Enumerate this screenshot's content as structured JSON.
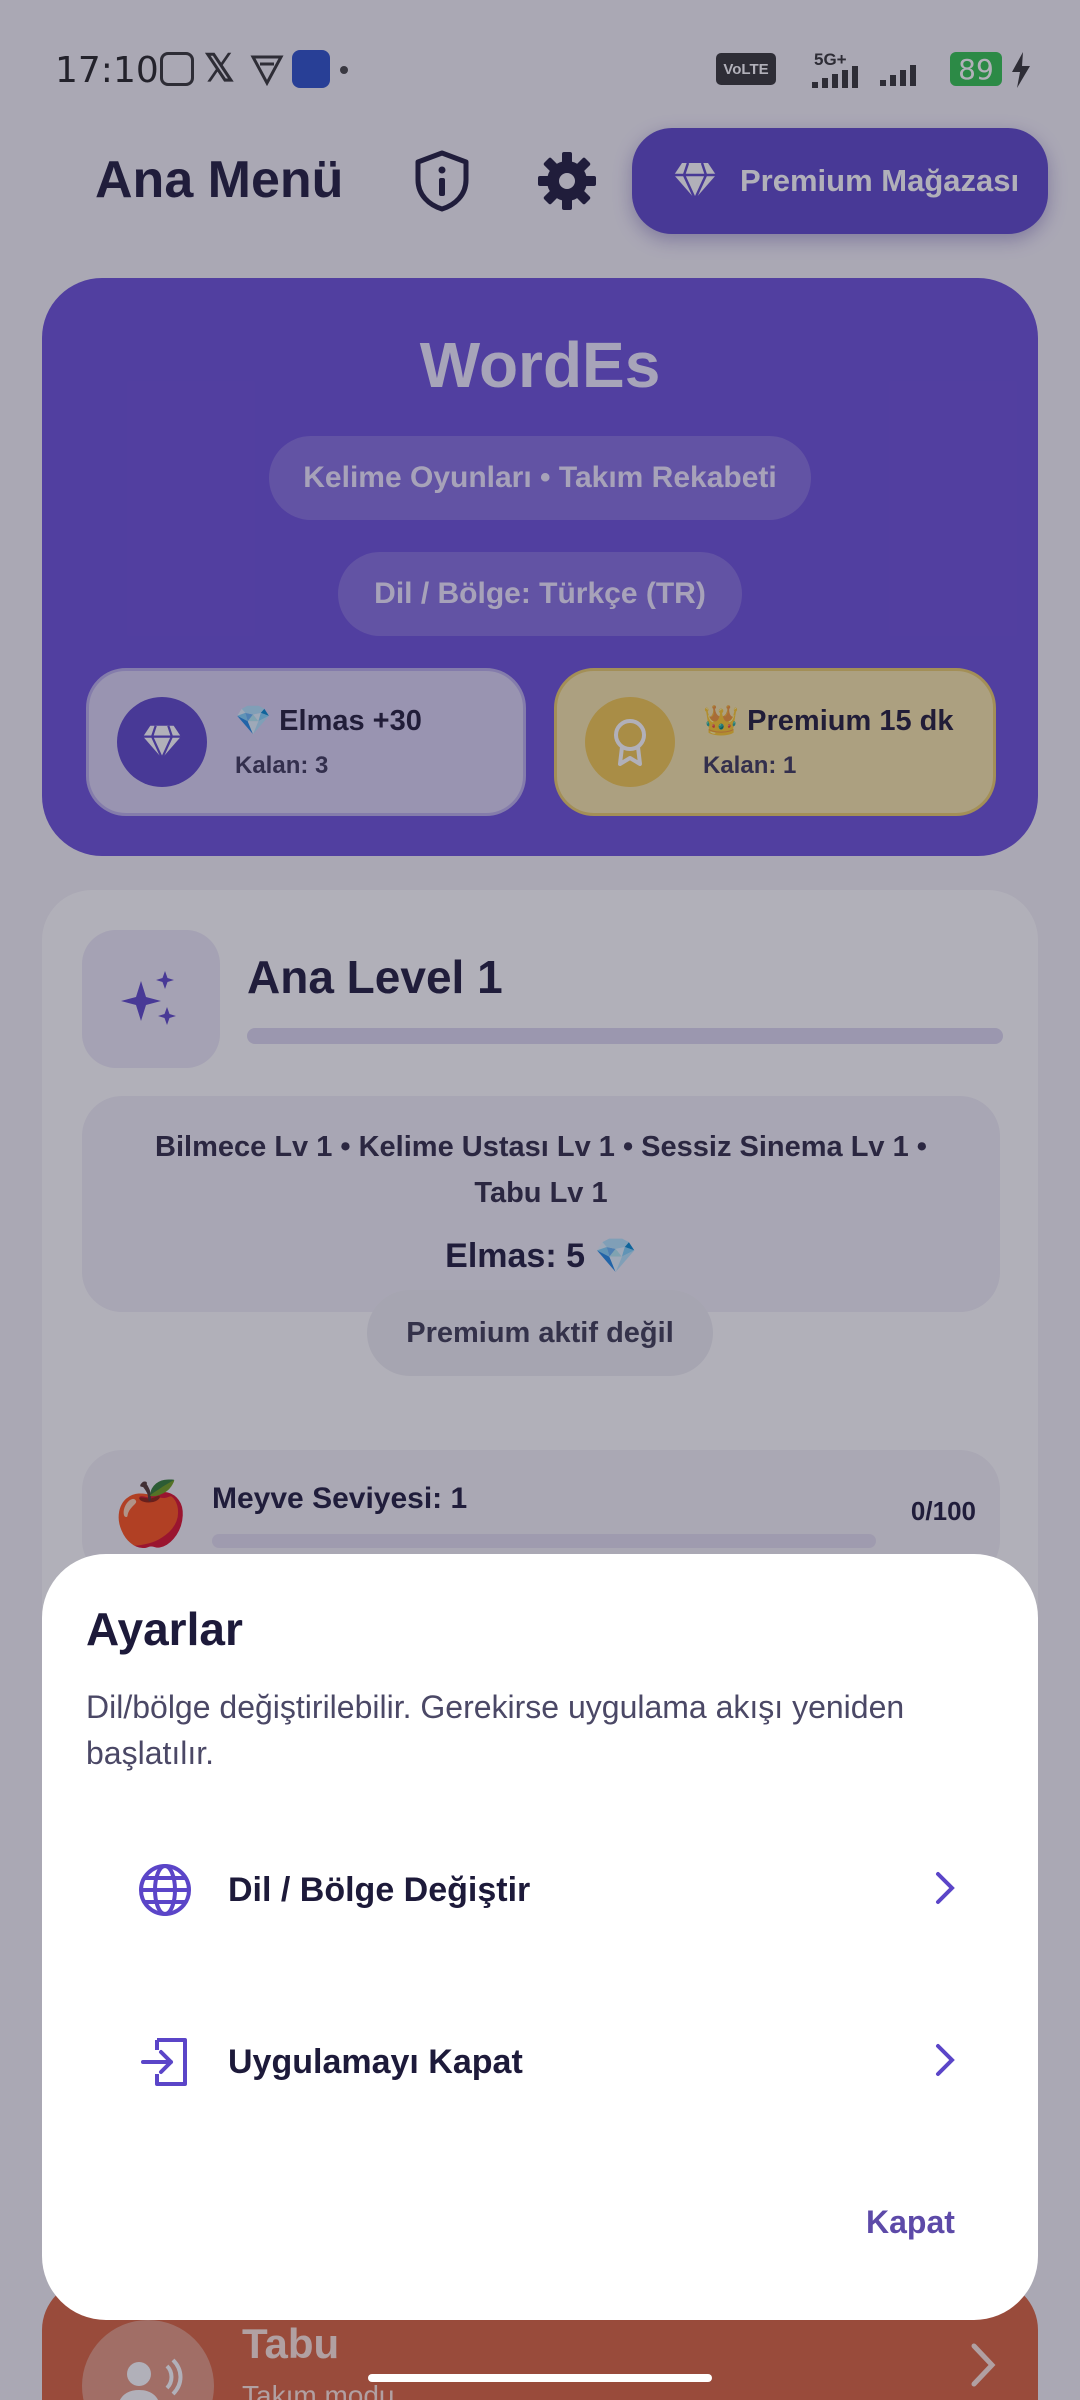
{
  "status_bar": {
    "time": "17:10",
    "volte": "VoLTE",
    "network": "5G+",
    "battery": "89"
  },
  "header": {
    "title": "Ana Menü",
    "premium_store_label": "Premium Mağazası"
  },
  "hero": {
    "app_name": "WordEs",
    "tagline": "Kelime Oyunları • Takım Rekabeti",
    "language": "Dil / Bölge: Türkçe (TR)",
    "rewards": [
      {
        "title": "💎 Elmas +30",
        "remaining": "Kalan: 3"
      },
      {
        "title": "👑 Premium 15 dk",
        "remaining": "Kalan: 1"
      }
    ]
  },
  "level": {
    "title": "Ana Level 1",
    "modes": "Bilmece Lv 1 • Kelime Ustası Lv 1 • Sessiz Sinema Lv 1 • Tabu Lv 1",
    "gems": "Elmas: 5 💎",
    "premium_status": "Premium aktif değil",
    "fruit_emoji": "🍎",
    "fruit_label": "Meyve Seviyesi: 1",
    "fruit_count": "0/100",
    "fruit_progress": 0
  },
  "tabu_card": {
    "name": "Tabu",
    "subtitle": "Takım modu"
  },
  "dialog": {
    "title": "Ayarlar",
    "description": "Dil/bölge değiştirilebilir. Gerekirse uygulama akışı yeniden başlatılır.",
    "items": [
      {
        "label": "Dil / Bölge Değiştir",
        "icon": "globe-icon"
      },
      {
        "label": "Uygulamayı Kapat",
        "icon": "exit-icon"
      }
    ],
    "close_label": "Kapat"
  },
  "colors": {
    "primary": "#5b45c8",
    "hero": "#6a4fd8",
    "premium_gold": "#f2c84b",
    "tabu_orange": "#d9623a"
  }
}
